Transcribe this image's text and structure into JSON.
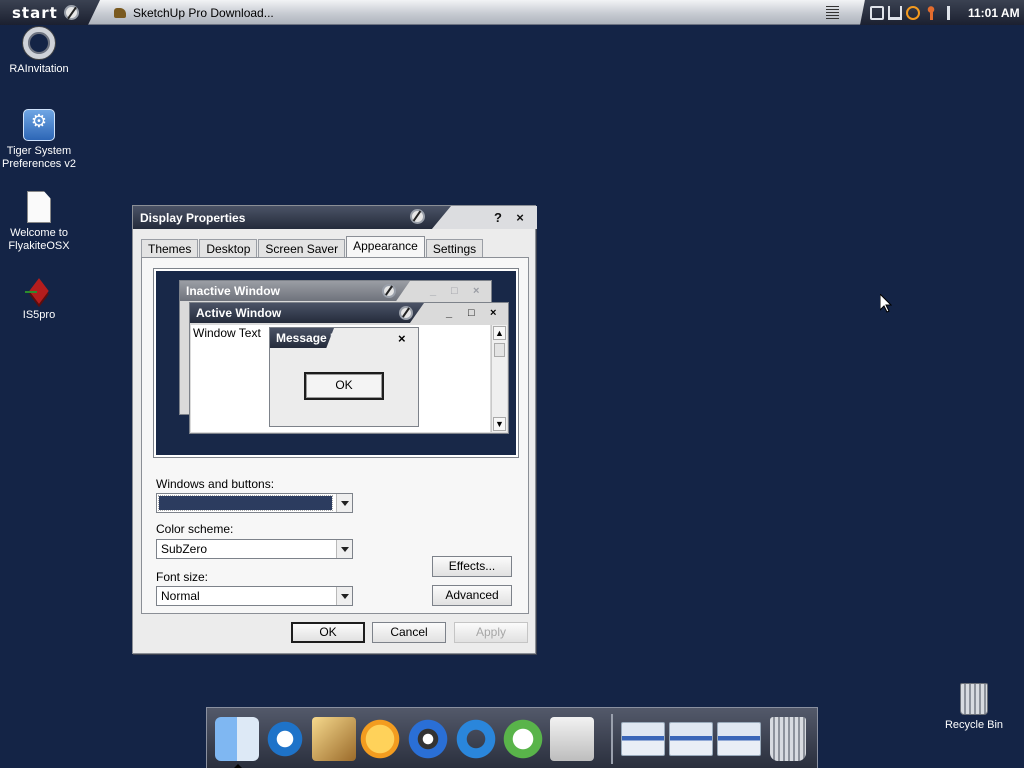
{
  "taskbar": {
    "start_label": "start",
    "task_title": "SketchUp Pro Download...",
    "clock": "11:01 AM"
  },
  "desktop_icons": [
    {
      "label": "RAInvitation",
      "icon": "ring-icon"
    },
    {
      "label": "Tiger System Preferences v2",
      "icon": "system-preferences-icon"
    },
    {
      "label": "Welcome to FlyakiteOSX",
      "icon": "document-icon"
    },
    {
      "label": "IS5pro",
      "icon": "package-icon"
    },
    {
      "label": "Recycle Bin",
      "icon": "recycle-bin-icon"
    }
  ],
  "dialog": {
    "title": "Display Properties",
    "help": "?",
    "close": "×",
    "tabs": [
      "Themes",
      "Desktop",
      "Screen Saver",
      "Appearance",
      "Settings"
    ],
    "active_tab": "Appearance",
    "preview": {
      "inactive_title": "Inactive Window",
      "active_title": "Active Window",
      "window_text": "Window Text",
      "message_title": "Message B...",
      "message_ok": "OK",
      "min": "_",
      "max": "□",
      "close": "×"
    },
    "windows_buttons_label": "Windows and buttons:",
    "windows_buttons_value": "",
    "color_scheme_label": "Color scheme:",
    "color_scheme_value": "SubZero",
    "font_size_label": "Font size:",
    "font_size_value": "Normal",
    "effects_label": "Effects...",
    "advanced_label": "Advanced",
    "ok_label": "OK",
    "cancel_label": "Cancel",
    "apply_label": "Apply"
  },
  "dock": {
    "items": [
      "finder-icon",
      "internet-explorer-icon",
      "mail-icon",
      "media-player-icon",
      "dvd-player-icon",
      "quicktime-icon",
      "itunes-icon",
      "apple-icon",
      "window-thumbnail-icon",
      "trash-icon"
    ]
  },
  "colors": {
    "desktop": "#142446",
    "titlebar": "#242b3b",
    "selection": "#2c3c5f"
  }
}
